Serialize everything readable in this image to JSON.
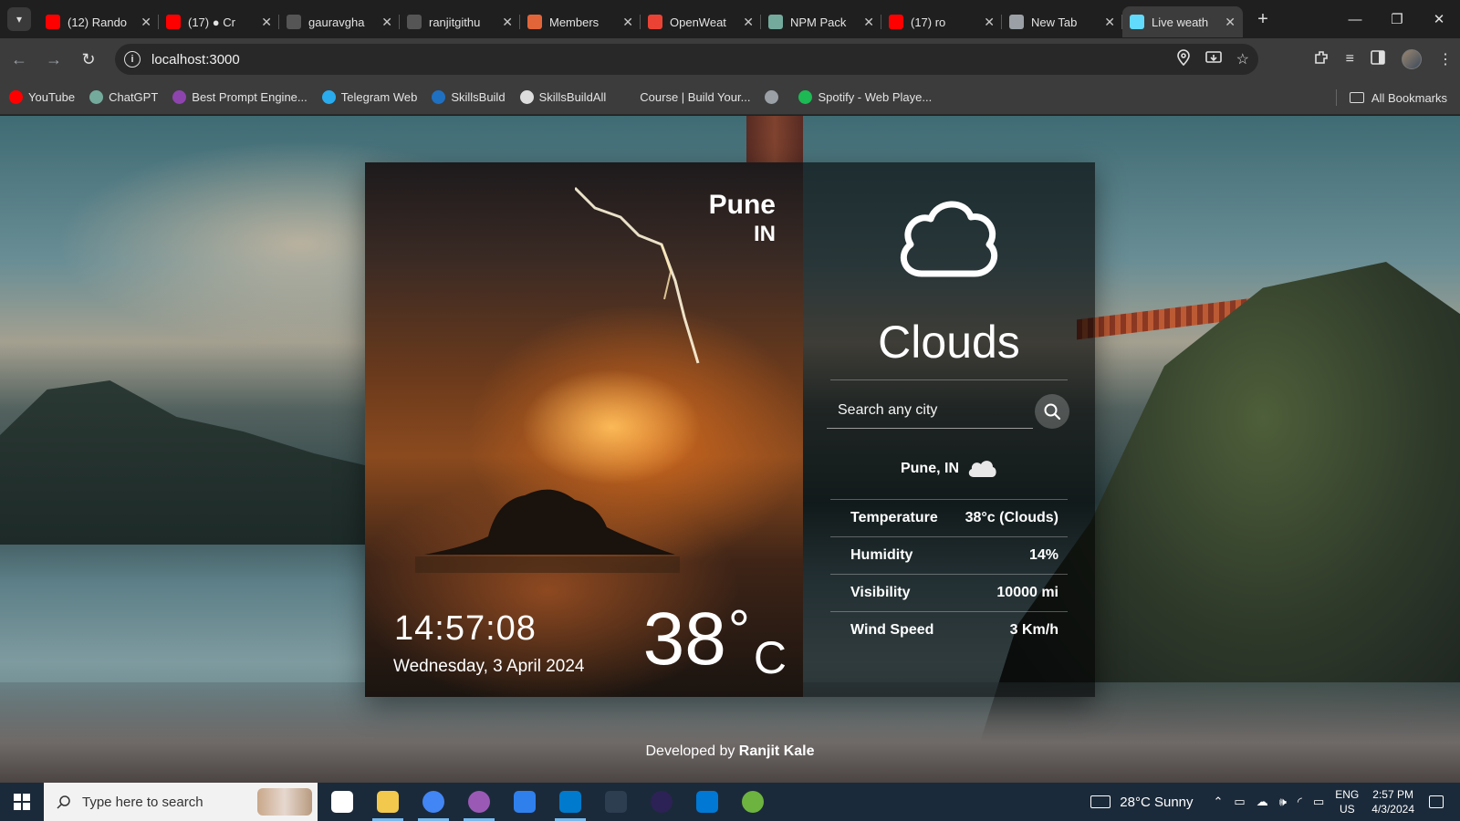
{
  "browser": {
    "tabs": [
      {
        "title": "(12) Rando",
        "favicon": "youtube-icon",
        "color": "#ff0000"
      },
      {
        "title": "(17) ● Cr",
        "favicon": "youtube-icon",
        "color": "#ff0000"
      },
      {
        "title": "gauravgha",
        "favicon": "github-icon",
        "color": "#555555"
      },
      {
        "title": "ranjitgithu",
        "favicon": "github-icon",
        "color": "#555555"
      },
      {
        "title": "Members",
        "favicon": "members-icon",
        "color": "#e2653a"
      },
      {
        "title": "OpenWeat",
        "favicon": "gmail-icon",
        "color": "#ea4335"
      },
      {
        "title": "NPM Pack",
        "favicon": "openai-icon",
        "color": "#74aa9c"
      },
      {
        "title": "(17) ro",
        "favicon": "youtube-icon",
        "color": "#ff0000"
      },
      {
        "title": "New Tab",
        "favicon": "chrome-icon",
        "color": "#9aa0a6"
      },
      {
        "title": "Live weath",
        "favicon": "react-icon",
        "color": "#61dafb"
      }
    ],
    "url": "localhost:3000",
    "bookmarks": [
      {
        "label": "YouTube",
        "color": "#ff0000"
      },
      {
        "label": "ChatGPT",
        "color": "#74aa9c"
      },
      {
        "label": "Best Prompt Engine...",
        "color": "#8e44ad"
      },
      {
        "label": "Telegram Web",
        "color": "#2aabee"
      },
      {
        "label": "SkillsBuild",
        "color": "#1f70c1"
      },
      {
        "label": "SkillsBuildAll",
        "color": "#dddddd"
      },
      {
        "label": "Course | Build Your...",
        "color": "#3c3c3c"
      },
      {
        "label": "",
        "color": "#9aa0a6"
      },
      {
        "label": "Spotify - Web Playe...",
        "color": "#1db954"
      }
    ],
    "all_bookmarks": "All Bookmarks"
  },
  "weather": {
    "city": "Pune",
    "country": "IN",
    "time": "14:57:08",
    "date": "Wednesday, 3 April 2024",
    "temp": "38",
    "deg": "°",
    "unit": "C",
    "condition": "Clouds",
    "search_placeholder": "Search any city",
    "location": "Pune, IN",
    "rows": [
      {
        "label": "Temperature",
        "value": "38°c (Clouds)"
      },
      {
        "label": "Humidity",
        "value": "14%"
      },
      {
        "label": "Visibility",
        "value": "10000 mi"
      },
      {
        "label": "Wind Speed",
        "value": "3 Km/h"
      }
    ],
    "footer_prefix": "Developed by ",
    "footer_name": "Ranjit Kale"
  },
  "taskbar": {
    "search_placeholder": "Type here to search",
    "weather": "28°C  Sunny",
    "lang1": "ENG",
    "lang2": "US",
    "time": "2:57 PM",
    "date": "4/3/2024",
    "apps": [
      {
        "name": "task-view-icon",
        "color": "#ffffff",
        "running": false
      },
      {
        "name": "file-explorer-icon",
        "color": "#f2c94c",
        "running": true
      },
      {
        "name": "chrome-icon",
        "color": "#4285f4",
        "running": true
      },
      {
        "name": "github-desktop-icon",
        "color": "#9b59b6",
        "running": true
      },
      {
        "name": "dev-icon",
        "color": "#2f80ed",
        "running": false
      },
      {
        "name": "vscode-icon",
        "color": "#007acc",
        "running": true
      },
      {
        "name": "mysql-icon",
        "color": "#2d3e50",
        "running": false
      },
      {
        "name": "eclipse-icon",
        "color": "#2c2255",
        "running": false
      },
      {
        "name": "mail-icon",
        "color": "#0078d4",
        "running": false
      },
      {
        "name": "spring-icon",
        "color": "#6db33f",
        "running": false
      }
    ]
  }
}
